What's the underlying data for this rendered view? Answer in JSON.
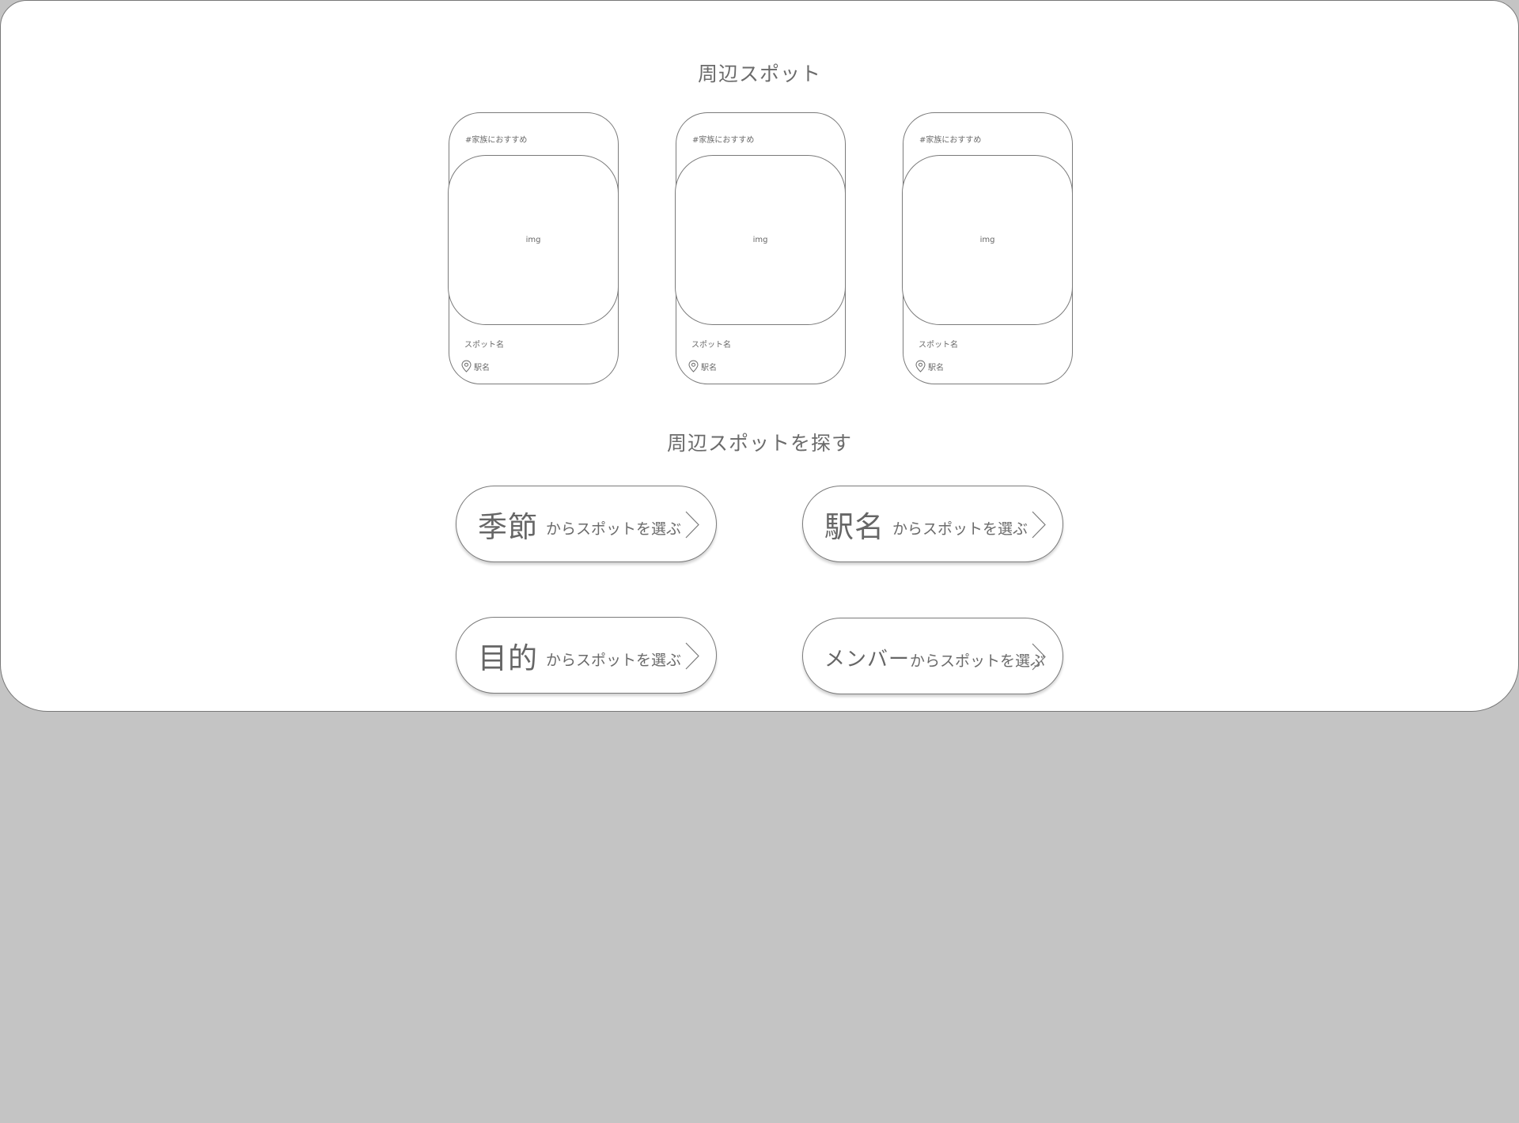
{
  "sections": {
    "nearby_title": "周辺スポット",
    "search_title": "周辺スポットを探す"
  },
  "cards": [
    {
      "tag": "#家族におすすめ",
      "img": "img",
      "spot_name": "スポット名",
      "station": "駅名"
    },
    {
      "tag": "#家族におすすめ",
      "img": "img",
      "spot_name": "スポット名",
      "station": "駅名"
    },
    {
      "tag": "#家族におすすめ",
      "img": "img",
      "spot_name": "スポット名",
      "station": "駅名"
    }
  ],
  "buttons": {
    "season": {
      "big": "季節",
      "small": "からスポットを選ぶ"
    },
    "station": {
      "big": "駅名",
      "small": "からスポットを選ぶ"
    },
    "purpose": {
      "big": "目的",
      "small": "からスポットを選ぶ"
    },
    "member": {
      "big": "メンバー",
      "small": "からスポットを選ぶ"
    }
  },
  "icons": {
    "location": "map-pin-icon",
    "chevron": "chevron-right-icon"
  },
  "colors": {
    "background": "#c4c4c4",
    "panel": "#ffffff",
    "stroke": "#7a7a7a",
    "text": "#666666"
  }
}
